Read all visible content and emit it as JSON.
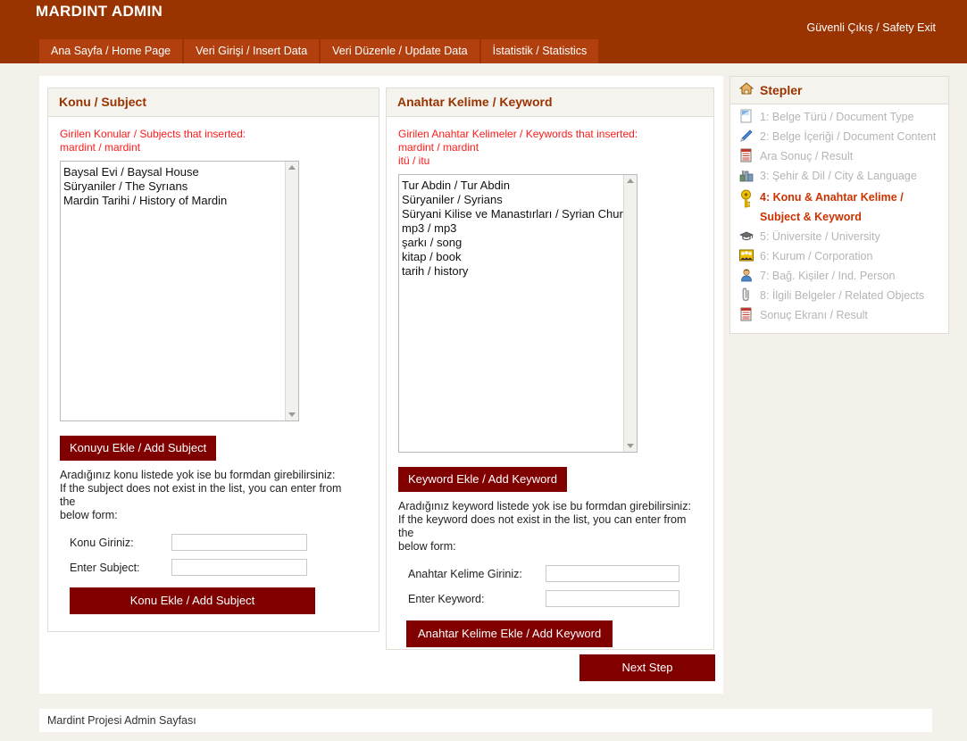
{
  "header": {
    "brand": "MARDINT ADMIN",
    "logout_label": "Güvenli Çıkış / Safety Exit",
    "bg_color": "#993300",
    "tab_color": "#b2400f",
    "tabs": [
      {
        "label": "Ana Sayfa / Home Page"
      },
      {
        "label": "Veri Girişi / Insert Data"
      },
      {
        "label": "Veri Düzenle / Update Data"
      },
      {
        "label": "İstatistik / Statistics"
      }
    ]
  },
  "subject_panel": {
    "title": "Konu / Subject",
    "inserted_header": "Girilen Konular / Subjects that inserted:",
    "inserted_items": [
      "mardint / mardint"
    ],
    "list_options": [
      "Baysal Evi / Baysal House",
      "Süryaniler / The Syrıans",
      "Mardin Tarihi / History of Mardin"
    ],
    "add_selected_button": "Konuyu Ekle / Add Subject",
    "help_line_1": "Aradığınız konu listede yok ise bu formdan girebilirsiniz:",
    "help_line_2": "If the subject does not exist in the list, you can enter from the",
    "help_line_3": "below form:",
    "field_tr_label": "Konu Giriniz:",
    "field_tr_value": "",
    "field_en_label": "Enter Subject:",
    "field_en_value": "",
    "submit_button": "Konu Ekle / Add Subject"
  },
  "keyword_panel": {
    "title": "Anahtar Kelime / Keyword",
    "inserted_header": "Girilen Anahtar Kelimeler / Keywords that inserted:",
    "inserted_items": [
      "mardint / mardint",
      "itü / itu"
    ],
    "list_options": [
      "Tur Abdin / Tur Abdin",
      "Süryaniler / Syrians",
      "Süryani Kilise ve Manastırları / Syrian Chur",
      "mp3 / mp3",
      "şarkı / song",
      "kitap / book",
      "tarih / history"
    ],
    "add_selected_button": "Keyword Ekle / Add Keyword",
    "help_line_1": "Aradığınız keyword listede yok ise bu formdan girebilirsiniz:",
    "help_line_2": "If the keyword does not exist in the list, you can enter from the",
    "help_line_3": "below form:",
    "field_tr_label": "Anahtar Kelime Giriniz:",
    "field_tr_value": "",
    "field_en_label": "Enter Keyword:",
    "field_en_value": "",
    "submit_button": "Anahtar Kelime Ekle / Add Keyword"
  },
  "next_step_button": "Next Step",
  "sidebar": {
    "title": "Stepler",
    "title_icon": "home-icon",
    "steps": [
      {
        "icon": "document-type-icon",
        "label": "1: Belge Türü / Document Type",
        "active": false
      },
      {
        "icon": "pencil-icon",
        "label": "2: Belge İçeriği / Document Content",
        "active": false
      },
      {
        "icon": "list-icon",
        "label": "Ara Sonuç / Result",
        "active": false
      },
      {
        "icon": "city-icon",
        "label": "3: Şehir & Dil / City & Language",
        "active": false
      },
      {
        "icon": "key-icon",
        "label": "4: Konu & Anahtar Kelime / Subject & Keyword",
        "active": true
      },
      {
        "icon": "graduation-cap-icon",
        "label": "5: Üniversite / University",
        "active": false
      },
      {
        "icon": "people-group-icon",
        "label": "6: Kurum / Corporation",
        "active": false
      },
      {
        "icon": "person-icon",
        "label": "7: Bağ. Kişiler / Ind. Person",
        "active": false
      },
      {
        "icon": "paperclip-icon",
        "label": "8: İlgili Belgeler / Related Objects",
        "active": false
      },
      {
        "icon": "list-icon",
        "label": "Sonuç Ekranı / Result",
        "active": false
      }
    ],
    "active_color": "#cc3300",
    "inactive_color": "#b5b5b5"
  },
  "footer": {
    "text": "Mardint Projesi Admin Sayfası"
  },
  "colors": {
    "brand_brown": "#993300",
    "tab_brown": "#b2400f",
    "button_dark_red": "#800000",
    "alert_red": "#ff1a1a",
    "page_bg": "#f4f1ea"
  }
}
